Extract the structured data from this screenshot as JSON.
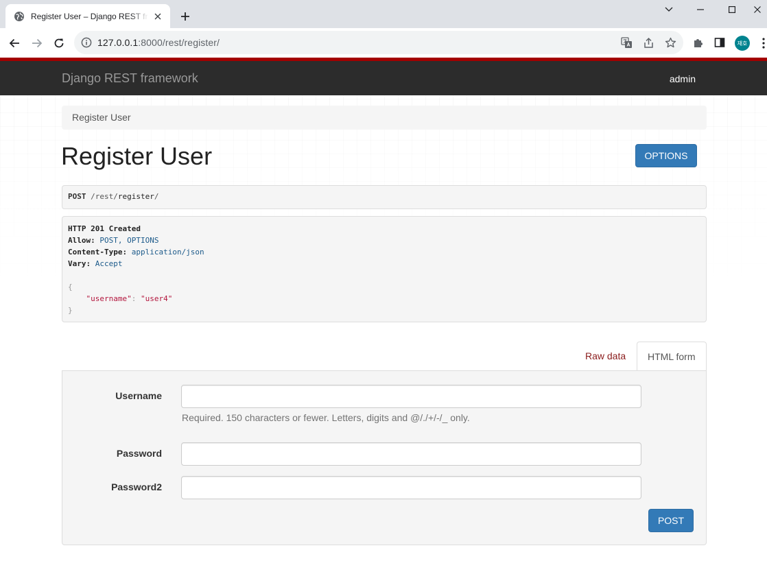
{
  "browser": {
    "tab_title": "Register User – Django REST framework",
    "url_host": "127.0.0.1",
    "url_rest": ":8000/rest/register/",
    "profile_initials": "재호",
    "accent_profile": "#00838f"
  },
  "navbar": {
    "brand": "Django REST framework",
    "user": "admin",
    "accent": "#a30000"
  },
  "breadcrumb": {
    "current": "Register User"
  },
  "page": {
    "title": "Register User",
    "options_label": "OPTIONS"
  },
  "request": {
    "method": "POST",
    "path_sep1": "/",
    "path_seg1": "rest",
    "path_sep2": "/",
    "path_seg2": "register",
    "path_sep3": "/"
  },
  "response": {
    "status": "HTTP 201 Created",
    "headers": [
      {
        "name": "Allow:",
        "value": "POST, OPTIONS"
      },
      {
        "name": "Content-Type:",
        "value": "application/json"
      },
      {
        "name": "Vary:",
        "value": "Accept"
      }
    ],
    "body_open": "{",
    "body_key": "\"username\"",
    "body_colon": ": ",
    "body_value": "\"user4\"",
    "body_close": "}"
  },
  "tabs": {
    "raw_data": "Raw data",
    "html_form": "HTML form"
  },
  "form": {
    "username_label": "Username",
    "username_value": "",
    "username_help": "Required. 150 characters or fewer. Letters, digits and @/./+/-/_ only.",
    "password_label": "Password",
    "password_value": "",
    "password2_label": "Password2",
    "password2_value": "",
    "submit_label": "POST"
  },
  "colors": {
    "primary_button": "#337ab7",
    "raw_tab_link": "#8a1b1b"
  }
}
